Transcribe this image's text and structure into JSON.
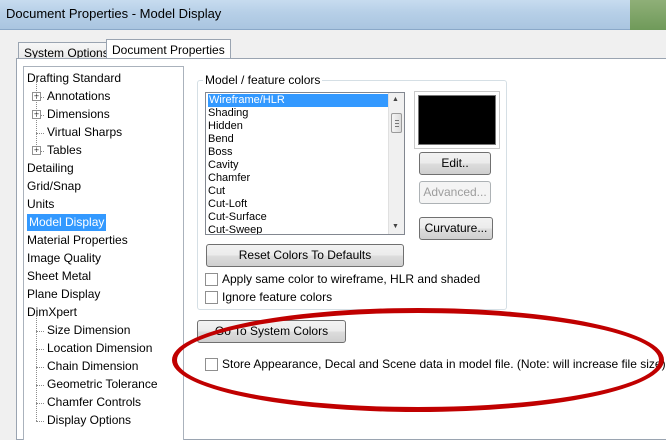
{
  "window": {
    "title": "Document Properties - Model Display"
  },
  "tabs": [
    {
      "label": "System Options",
      "underline": "S",
      "rest": "ystem Options",
      "active": false
    },
    {
      "label": "Document Properties",
      "active": true
    }
  ],
  "tree": [
    {
      "label": "Drafting Standard",
      "level": 0,
      "expander": false
    },
    {
      "label": "Annotations",
      "level": 1,
      "expander": true
    },
    {
      "label": "Dimensions",
      "level": 1,
      "expander": true
    },
    {
      "label": "Virtual Sharps",
      "level": 1,
      "expander": false
    },
    {
      "label": "Tables",
      "level": 1,
      "expander": true
    },
    {
      "label": "Detailing",
      "level": 0
    },
    {
      "label": "Grid/Snap",
      "level": 0
    },
    {
      "label": "Units",
      "level": 0
    },
    {
      "label": "Model Display",
      "level": 0,
      "selected": true
    },
    {
      "label": "Material Properties",
      "level": 0
    },
    {
      "label": "Image Quality",
      "level": 0
    },
    {
      "label": "Sheet Metal",
      "level": 0
    },
    {
      "label": "Plane Display",
      "level": 0
    },
    {
      "label": "DimXpert",
      "level": 0
    },
    {
      "label": "Size Dimension",
      "level": 1
    },
    {
      "label": "Location Dimension",
      "level": 1
    },
    {
      "label": "Chain Dimension",
      "level": 1
    },
    {
      "label": "Geometric Tolerance",
      "level": 1
    },
    {
      "label": "Chamfer Controls",
      "level": 1
    },
    {
      "label": "Display Options",
      "level": 1
    }
  ],
  "model_colors": {
    "group_label": "Model / feature colors",
    "items": [
      "Wireframe/HLR",
      "Shading",
      "Hidden",
      "Bend",
      "Boss",
      "Cavity",
      "Chamfer",
      "Cut",
      "Cut-Loft",
      "Cut-Surface",
      "Cut-Sweep"
    ],
    "selected_index": 0,
    "swatch_color": "#000000",
    "edit_button": "Edit..",
    "advanced_button": "Advanced...",
    "curvature_button": "Curvature...",
    "reset_button": "Reset Colors To Defaults"
  },
  "options": {
    "apply_same_color": "Apply same color to wireframe, HLR and shaded",
    "ignore_feature_colors": "Ignore feature colors",
    "go_to_system_colors": "Go To System Colors",
    "store_appearance": "Store Appearance, Decal and Scene data in model file. (Note: will increase file size)"
  },
  "colors": {
    "selection": "#3399ff",
    "annotation_ellipse": "#c00000"
  }
}
